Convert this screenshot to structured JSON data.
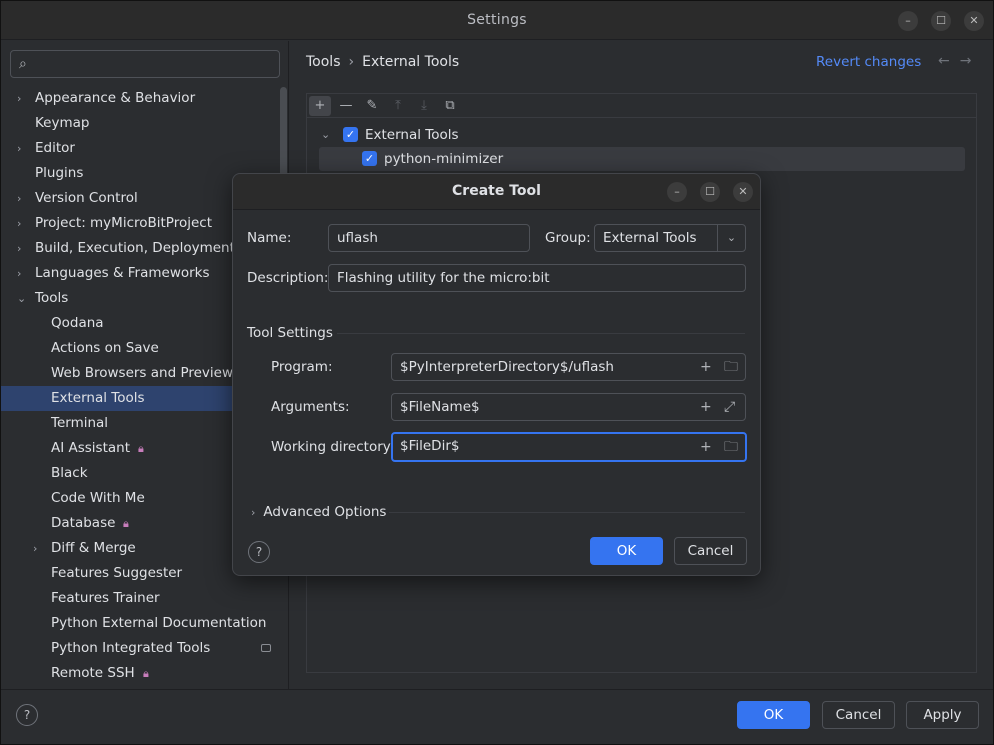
{
  "window": {
    "title": "Settings"
  },
  "sidebar": {
    "search_placeholder": "",
    "items": [
      {
        "label": "Appearance & Behavior",
        "expandable": true,
        "expanded": false,
        "child": false
      },
      {
        "label": "Keymap",
        "expandable": false,
        "child": false
      },
      {
        "label": "Editor",
        "expandable": true,
        "expanded": false,
        "child": false
      },
      {
        "label": "Plugins",
        "expandable": false,
        "child": false
      },
      {
        "label": "Version Control",
        "expandable": true,
        "expanded": false,
        "child": false
      },
      {
        "label": "Project: myMicroBitProject",
        "expandable": true,
        "expanded": false,
        "child": false
      },
      {
        "label": "Build, Execution, Deployment",
        "expandable": true,
        "expanded": false,
        "child": false
      },
      {
        "label": "Languages & Frameworks",
        "expandable": true,
        "expanded": false,
        "child": false
      },
      {
        "label": "Tools",
        "expandable": true,
        "expanded": true,
        "child": false
      },
      {
        "label": "Qodana",
        "child": true
      },
      {
        "label": "Actions on Save",
        "child": true
      },
      {
        "label": "Web Browsers and Preview",
        "child": true
      },
      {
        "label": "External Tools",
        "child": true,
        "selected": true
      },
      {
        "label": "Terminal",
        "child": true
      },
      {
        "label": "AI Assistant",
        "child": true,
        "locked": true
      },
      {
        "label": "Black",
        "child": true
      },
      {
        "label": "Code With Me",
        "child": true
      },
      {
        "label": "Database",
        "child": true,
        "locked": true
      },
      {
        "label": "Diff & Merge",
        "child": true,
        "expandable": true,
        "expanded": false
      },
      {
        "label": "Features Suggester",
        "child": true
      },
      {
        "label": "Features Trainer",
        "child": true
      },
      {
        "label": "Python External Documentation",
        "child": true
      },
      {
        "label": "Python Integrated Tools",
        "child": true,
        "badge": true
      },
      {
        "label": "Remote SSH",
        "child": true,
        "locked": true
      }
    ]
  },
  "main": {
    "breadcrumb": [
      "Tools",
      "External Tools"
    ],
    "revert_label": "Revert changes",
    "tree": {
      "group_label": "External Tools",
      "tool_label": "python-minimizer"
    }
  },
  "dialog": {
    "title": "Create Tool",
    "name_label": "Name:",
    "name_value": "uflash",
    "group_label": "Group:",
    "group_value": "External Tools",
    "description_label": "Description:",
    "description_value": "Flashing utility for the micro:bit",
    "tool_settings_label": "Tool Settings",
    "program_label": "Program:",
    "program_value": "$PyInterpreterDirectory$/uflash",
    "arguments_label": "Arguments:",
    "arguments_value": "$FileName$",
    "workdir_label": "Working directory:",
    "workdir_value": "$FileDir$",
    "advanced_label": "Advanced Options",
    "ok_label": "OK",
    "cancel_label": "Cancel"
  },
  "footer": {
    "ok_label": "OK",
    "cancel_label": "Cancel",
    "apply_label": "Apply"
  },
  "colors": {
    "accent": "#3574f0",
    "link": "#548af7",
    "selection": "#2e436e",
    "lock": "#c77dbb"
  }
}
